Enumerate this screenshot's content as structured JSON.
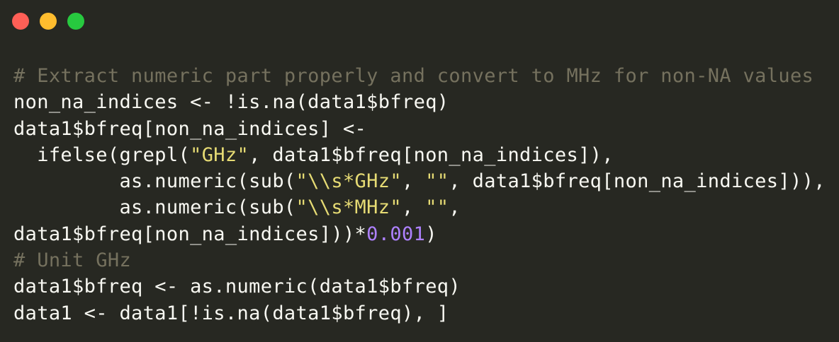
{
  "window": {
    "background": "#272822",
    "controls": [
      {
        "name": "close",
        "color": "#ff5f56"
      },
      {
        "name": "minimize",
        "color": "#ffbd2e"
      },
      {
        "name": "zoom",
        "color": "#27c93f"
      }
    ]
  },
  "colors": {
    "text": "#f8f8f2",
    "comment": "#75715e",
    "string": "#e6db74",
    "number": "#ae81ff"
  },
  "code": {
    "language": "R",
    "lines": [
      [
        {
          "t": "cmt",
          "v": "# Extract numeric part properly and convert to MHz for non-NA values"
        }
      ],
      [
        {
          "t": "txt",
          "v": "non_na_indices <- !is.na(data1$bfreq)"
        }
      ],
      [
        {
          "t": "txt",
          "v": "data1$bfreq[non_na_indices] <-"
        }
      ],
      [
        {
          "t": "txt",
          "v": "  ifelse(grepl("
        },
        {
          "t": "str",
          "v": "\"GHz\""
        },
        {
          "t": "txt",
          "v": ", data1$bfreq[non_na_indices]),"
        }
      ],
      [
        {
          "t": "txt",
          "v": "         as.numeric(sub("
        },
        {
          "t": "str",
          "v": "\"\\\\s*GHz\""
        },
        {
          "t": "txt",
          "v": ", "
        },
        {
          "t": "str",
          "v": "\"\""
        },
        {
          "t": "txt",
          "v": ", data1$bfreq[non_na_indices])),"
        }
      ],
      [
        {
          "t": "txt",
          "v": "         as.numeric(sub("
        },
        {
          "t": "str",
          "v": "\"\\\\s*MHz\""
        },
        {
          "t": "txt",
          "v": ", "
        },
        {
          "t": "str",
          "v": "\"\""
        },
        {
          "t": "txt",
          "v": ","
        }
      ],
      [
        {
          "t": "txt",
          "v": "data1$bfreq[non_na_indices]))*"
        },
        {
          "t": "num",
          "v": "0.001"
        },
        {
          "t": "txt",
          "v": ")"
        }
      ],
      [
        {
          "t": "cmt",
          "v": "# Unit GHz"
        }
      ],
      [
        {
          "t": "txt",
          "v": "data1$bfreq <- as.numeric(data1$bfreq)"
        }
      ],
      [
        {
          "t": "txt",
          "v": "data1 <- data1[!is.na(data1$bfreq), ]"
        }
      ]
    ]
  }
}
